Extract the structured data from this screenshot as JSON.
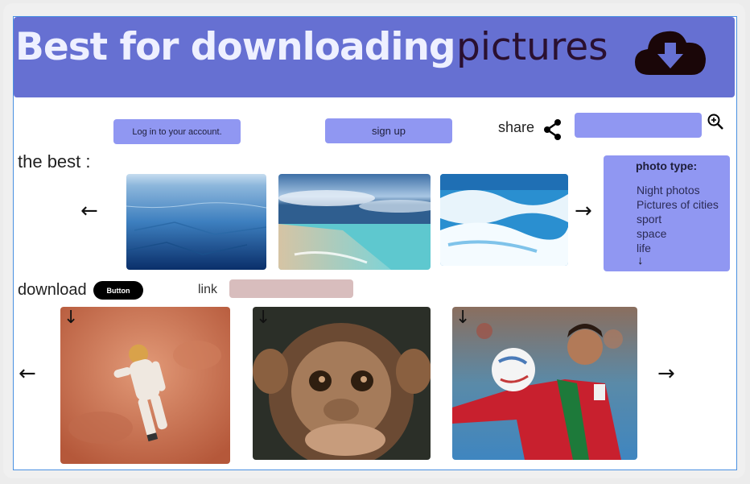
{
  "header": {
    "title_bold": "Best for downloading",
    "title_light": "pictures",
    "icon": "cloud-download-icon"
  },
  "toolbar": {
    "login_label": "Log in to your account.",
    "signup_label": "sign up",
    "share_label": "share",
    "share_icon": "share-icon",
    "search_placeholder": "",
    "search_icon": "zoom-in-icon"
  },
  "best_section": {
    "label": "the best :",
    "prev_arrow": "←",
    "next_arrow": "→",
    "images": [
      "ice-field-image",
      "beach-sky-image",
      "ocean-wave-image"
    ]
  },
  "photo_type_panel": {
    "title": "photo type:",
    "items": [
      "Night photos",
      "Pictures of cities",
      "sport",
      "space",
      "life"
    ],
    "more_arrow": "↓"
  },
  "download_section": {
    "label": "download",
    "button_label": "Button",
    "link_label": "link",
    "link_value": "",
    "prev_arrow": "←",
    "next_arrow": "→",
    "download_arrow": "↓",
    "images": [
      "astronaut-image",
      "monkey-image",
      "footballer-image"
    ]
  },
  "colors": {
    "header_bg": "#6670d2",
    "accent": "#9097f2",
    "link_field": "#d8bdbd",
    "frame_border": "#4a90e2"
  }
}
